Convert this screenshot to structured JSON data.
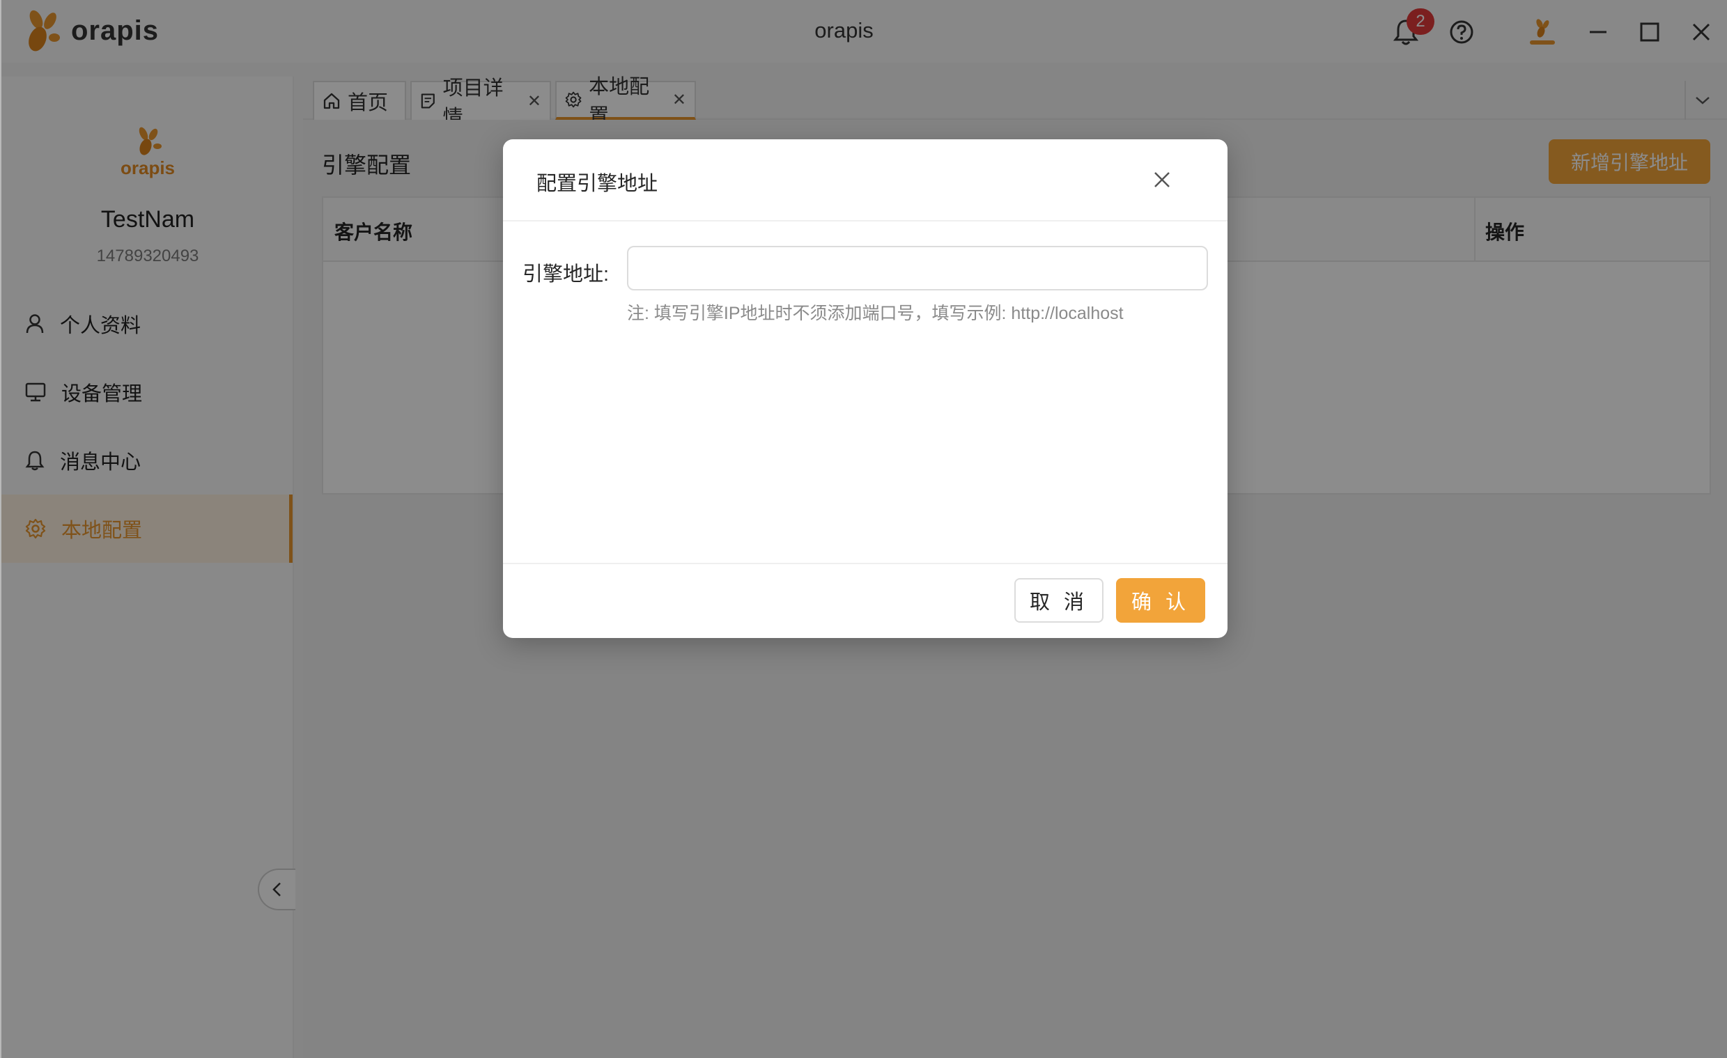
{
  "window": {
    "app_name": "orapis",
    "title": "orapis",
    "notification_count": "2"
  },
  "sidebar": {
    "logo_text": "orapis",
    "username": "TestNam",
    "phone": "14789320493",
    "items": [
      {
        "label": "个人资料",
        "icon": "user-icon",
        "active": false
      },
      {
        "label": "设备管理",
        "icon": "monitor-icon",
        "active": false
      },
      {
        "label": "消息中心",
        "icon": "bell-icon",
        "active": false
      },
      {
        "label": "本地配置",
        "icon": "gear-icon",
        "active": true
      }
    ]
  },
  "tabs": [
    {
      "label": "首页",
      "icon": "home-icon",
      "closable": false
    },
    {
      "label": "项目详情",
      "icon": "document-icon",
      "closable": true
    },
    {
      "label": "本地配置",
      "icon": "gear-icon",
      "closable": true,
      "active": true
    }
  ],
  "page": {
    "title": "引擎配置",
    "add_button": "新增引擎地址",
    "columns": [
      "客户名称",
      "操作"
    ]
  },
  "modal": {
    "title": "配置引擎地址",
    "field_label": "引擎地址:",
    "field_value": "",
    "hint": "注: 填写引擎IP地址时不须添加端口号，填写示例: http://localhost",
    "cancel": "取 消",
    "confirm": "确 认"
  },
  "colors": {
    "accent": "#f2a43a",
    "badge": "#e03a3a"
  }
}
